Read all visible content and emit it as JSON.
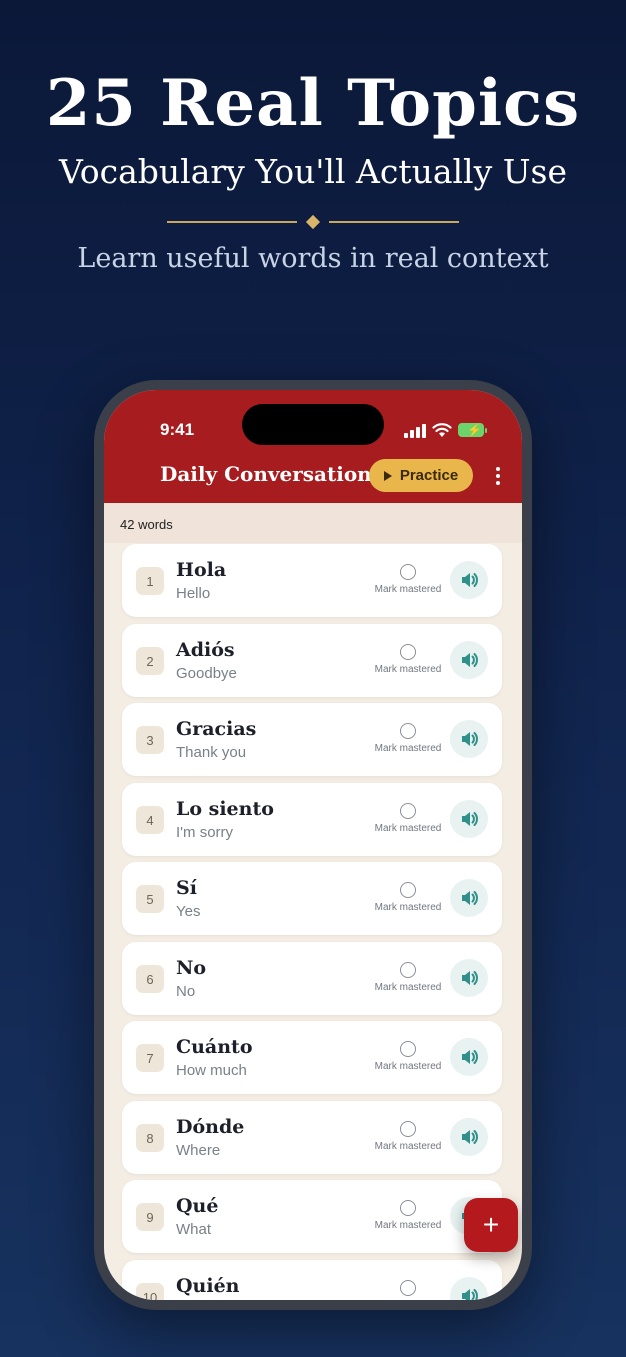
{
  "promo": {
    "title": "25 Real Topics",
    "subtitle": "Vocabulary You'll Actually Use",
    "tagline": "Learn useful words in real context"
  },
  "status_bar": {
    "time": "9:41"
  },
  "app": {
    "title": "Daily Conversation",
    "practice_label": "Practice",
    "word_count": "42 words",
    "mark_label": "Mark mastered",
    "fab_label": "+"
  },
  "colors": {
    "background": "#0b1838",
    "appbar": "#a71d1f",
    "accent_gold": "#e8b64a",
    "speak_teal": "#2f8f8a"
  },
  "words": [
    {
      "num": "1",
      "word": "Hola",
      "translation": "Hello"
    },
    {
      "num": "2",
      "word": "Adiós",
      "translation": "Goodbye"
    },
    {
      "num": "3",
      "word": "Gracias",
      "translation": "Thank you"
    },
    {
      "num": "4",
      "word": "Lo siento",
      "translation": "I'm sorry"
    },
    {
      "num": "5",
      "word": "Sí",
      "translation": "Yes"
    },
    {
      "num": "6",
      "word": "No",
      "translation": "No"
    },
    {
      "num": "7",
      "word": "Cuánto",
      "translation": "How much"
    },
    {
      "num": "8",
      "word": "Dónde",
      "translation": "Where"
    },
    {
      "num": "9",
      "word": "Qué",
      "translation": "What"
    },
    {
      "num": "10",
      "word": "Quién",
      "translation": ""
    }
  ]
}
